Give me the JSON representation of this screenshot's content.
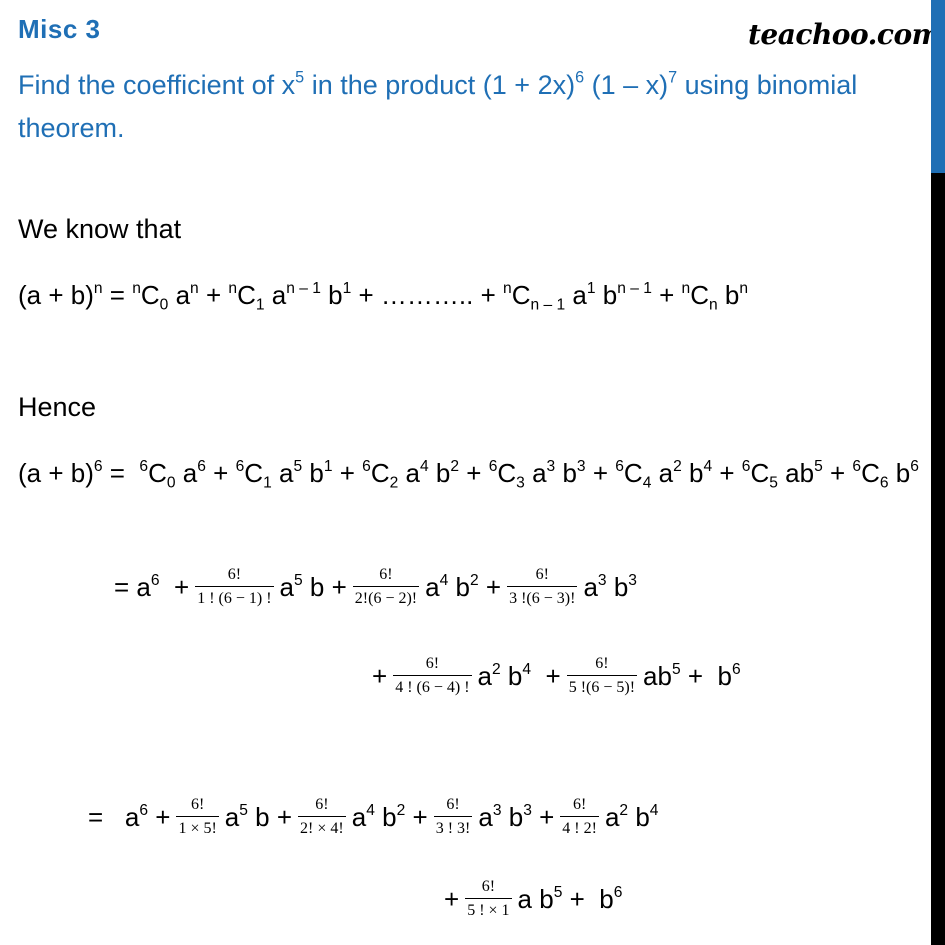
{
  "header": {
    "title": "Misc  3",
    "brand": "teachoo.com"
  },
  "question": {
    "line1_a": "Find the coefficient of x",
    "line1_sup1": "5",
    "line1_b": " in the product (1 + 2x)",
    "line1_sup2": "6",
    "line1_c": " (1 – x)",
    "line1_sup3": "7",
    "line1_d": " using binomial",
    "line2": "theorem."
  },
  "body": {
    "we_know": "We know that",
    "hence": "Hence"
  },
  "formula_general": "(a + b)^n = nC0 a^n + nC1 a^(n-1) b^1 + ........... + nC(n-1) a^1 b^(n-1) + nCn b^n",
  "formula_six": "(a + b)^6 = 6C0 a^6 + 6C1 a^5 b^1 + 6C2 a^4 b^2 + 6C3 a^3 b^3 + 6C4 a^2 b^4 + 6C5 ab^5 + 6C6 b^6",
  "step1": {
    "fractions": [
      {
        "num": "6!",
        "den": "1 ! (6 − 1) !"
      },
      {
        "num": "6!",
        "den": "2!(6 − 2)!"
      },
      {
        "num": "6!",
        "den": "3 !(6 − 3)!"
      },
      {
        "num": "6!",
        "den": "4 ! (6 − 4) !"
      },
      {
        "num": "6!",
        "den": "5 !(6 − 5)!"
      }
    ]
  },
  "step2": {
    "fractions": [
      {
        "num": "6!",
        "den": "1  × 5!"
      },
      {
        "num": "6!",
        "den": "2! × 4!"
      },
      {
        "num": "6!",
        "den": "3 ! 3!"
      },
      {
        "num": "6!",
        "den": "4 ! 2!"
      },
      {
        "num": "6!",
        "den": "5 ! × 1"
      }
    ]
  },
  "scrollbar": {
    "position_fraction": 0.0,
    "thumb_fraction": 0.18,
    "thumb_color": "#1f6fb5"
  },
  "colors": {
    "accent": "#1f6fb5",
    "text": "#000000"
  }
}
